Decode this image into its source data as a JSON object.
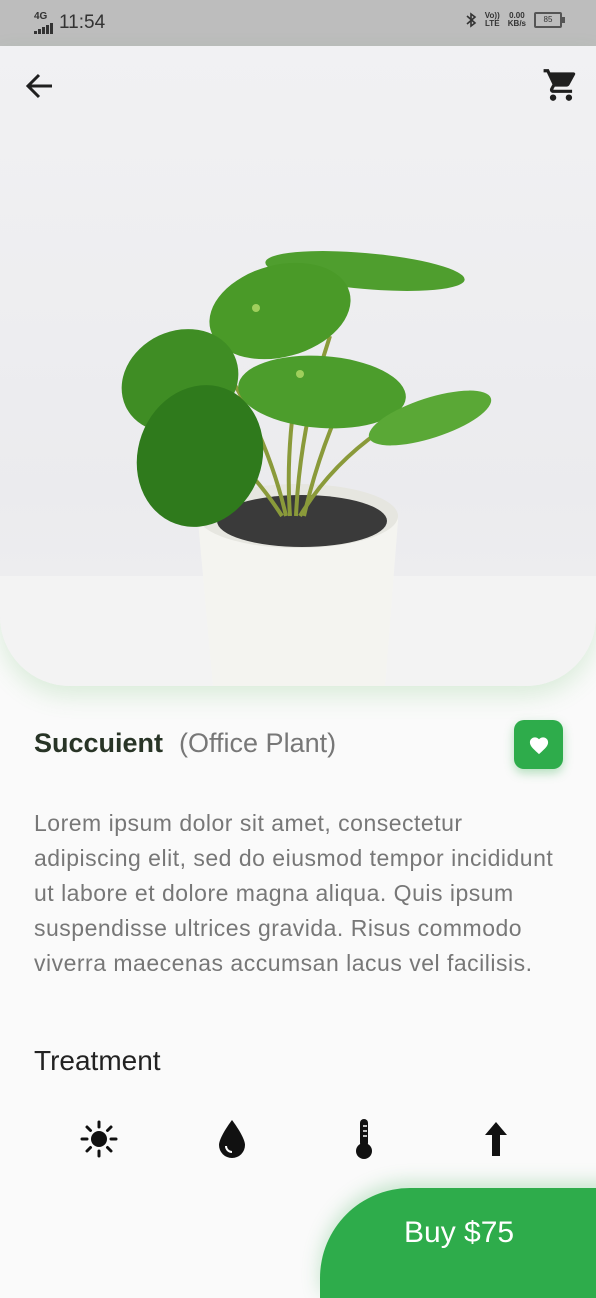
{
  "status_bar": {
    "network": "4G",
    "time": "11:54",
    "volte_top": "Vo))",
    "volte_bottom": "LTE",
    "speed_value": "0.00",
    "speed_unit": "KB/s",
    "battery": "85"
  },
  "header": {
    "back_icon": "arrow-left-icon",
    "cart_icon": "shopping-cart-icon"
  },
  "product": {
    "name": "Succuient",
    "category": "(Office Plant)",
    "favorite_icon": "heart-icon",
    "description": "Lorem ipsum dolor sit amet, consectetur adipiscing elit, sed do eiusmod tempor incididunt ut labore et dolore magna aliqua. Quis ipsum suspendisse ultrices gravida. Risus commodo viverra maecenas accumsan lacus vel facilisis."
  },
  "treatment": {
    "title": "Treatment",
    "icons": [
      "sun-icon",
      "water-drop-icon",
      "thermometer-icon",
      "arrow-up-icon"
    ]
  },
  "buy_button": {
    "label": "Buy $75"
  },
  "colors": {
    "accent": "#2eac4b",
    "title_text": "#283426",
    "body_text": "#777777",
    "background": "#fafafa"
  }
}
